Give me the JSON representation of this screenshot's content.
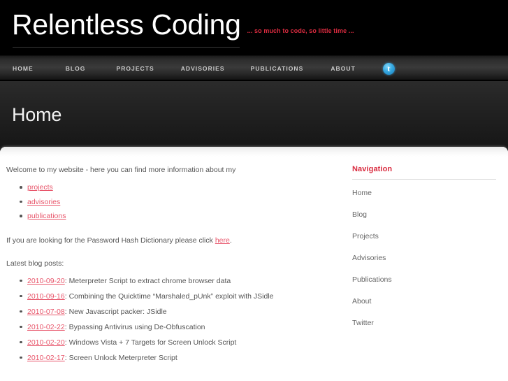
{
  "header": {
    "site_title": "Relentless Coding",
    "tagline": "... so much to code, so little time ...",
    "nav": [
      {
        "label": "HOME"
      },
      {
        "label": "BLOG"
      },
      {
        "label": "PROJECTS"
      },
      {
        "label": "ADVISORIES"
      },
      {
        "label": "PUBLICATIONS"
      },
      {
        "label": "ABOUT"
      }
    ],
    "twitter_icon_label": "t"
  },
  "page": {
    "title": "Home"
  },
  "main": {
    "intro": "Welcome to my website - here you can find more information about my",
    "intro_links": [
      {
        "label": "projects"
      },
      {
        "label": "advisories"
      },
      {
        "label": "publications"
      }
    ],
    "hash_dictionary_before": "If you are looking for the Password Hash Dictionary please click ",
    "hash_dictionary_link": "here",
    "hash_dictionary_after": ".",
    "latest_label": "Latest blog posts:",
    "posts": [
      {
        "date": "2010-09-20",
        "sep": ": ",
        "title": "Meterpreter Script to extract chrome browser data"
      },
      {
        "date": "2010-09-16",
        "sep": ": ",
        "title": "Combining the Quicktime “Marshaled_pUnk” exploit with JSidle"
      },
      {
        "date": "2010-07-08",
        "sep": ": ",
        "title": "New Javascript packer: JSidle"
      },
      {
        "date": "2010-02-22",
        "sep": ": ",
        "title": "Bypassing Antivirus using De-Obfuscation"
      },
      {
        "date": "2010-02-20",
        "sep": ": ",
        "title": "Windows Vista + 7 Targets for Screen Unlock Script"
      },
      {
        "date": "2010-02-17",
        "sep": ": ",
        "title": "Screen Unlock Meterpreter Script"
      }
    ]
  },
  "sidebar": {
    "title": "Navigation",
    "items": [
      {
        "label": "Home"
      },
      {
        "label": "Blog"
      },
      {
        "label": "Projects"
      },
      {
        "label": "Advisories"
      },
      {
        "label": "Publications"
      },
      {
        "label": "About"
      },
      {
        "label": "Twitter"
      }
    ]
  },
  "colors": {
    "accent_red": "#d92b3f",
    "link_red": "#e8566b",
    "body_text": "#555555",
    "sidebar_text": "#666666",
    "background_black": "#000000",
    "panel_white": "#ffffff",
    "twitter_blue": "#36a8e0"
  }
}
